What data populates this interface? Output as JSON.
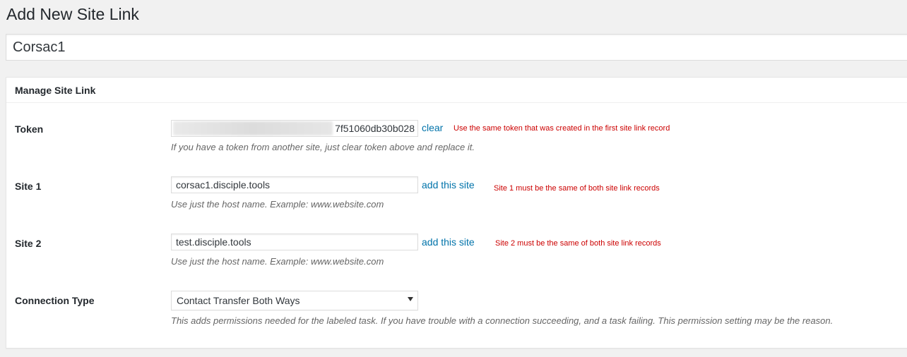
{
  "page": {
    "title": "Add New Site Link",
    "post_title_value": "Corsac1"
  },
  "postbox": {
    "title": "Manage Site Link"
  },
  "token": {
    "label": "Token",
    "visible_value": "7f51060db30b028",
    "clear_label": "clear",
    "note": "Use the same token that was created in the first site link record",
    "description": "If you have a token from another site, just clear token above and replace it."
  },
  "site1": {
    "label": "Site 1",
    "value": "corsac1.disciple.tools",
    "link_label": "add this site",
    "note": "Site 1 must be the same of both site link records",
    "description": "Use just the host name. Example: www.website.com"
  },
  "site2": {
    "label": "Site 2",
    "value": "test.disciple.tools",
    "link_label": "add this site",
    "note": "Site 2 must be the same of both site link records",
    "description": "Use just the host name. Example: www.website.com"
  },
  "connection": {
    "label": "Connection Type",
    "selected": "Contact Transfer Both Ways",
    "description": "This adds permissions needed for the labeled task. If you have trouble with a connection succeeding, and a task failing. This permission setting may be the reason."
  },
  "colors": {
    "link": "#0073aa",
    "note": "#cc0000",
    "background": "#f1f1f1"
  }
}
